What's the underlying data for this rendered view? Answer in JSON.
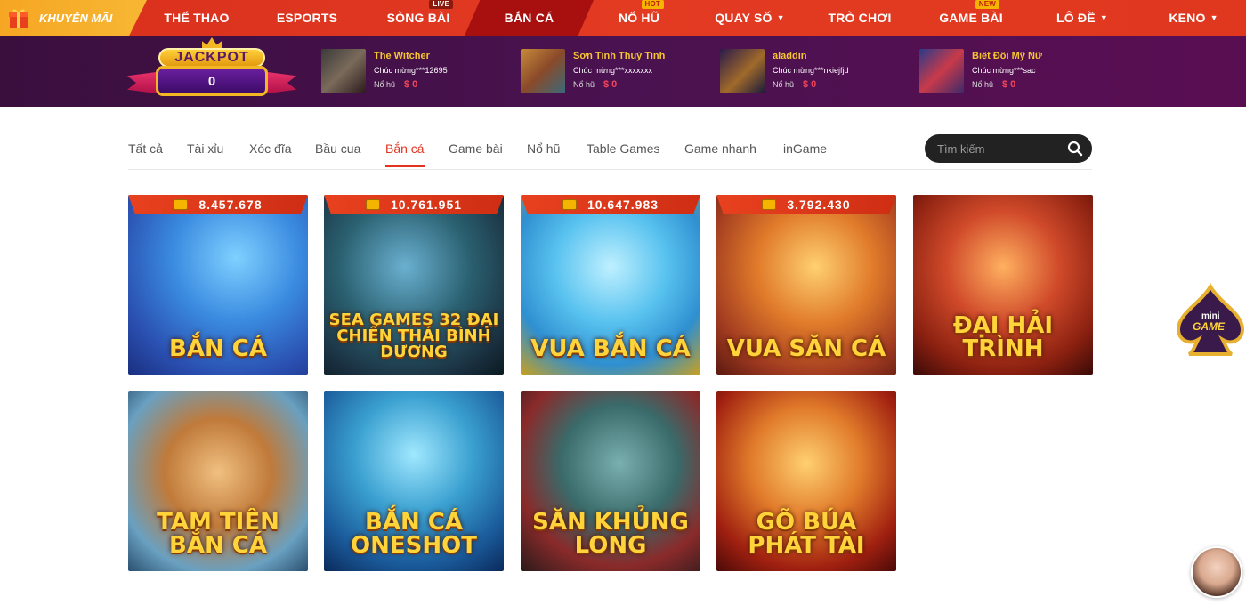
{
  "nav": {
    "promo_label": "KHUYẾN MÃI",
    "items": [
      {
        "label": "THỂ THAO",
        "badge": ""
      },
      {
        "label": "ESPORTS",
        "badge": ""
      },
      {
        "label": "SÒNG BÀI",
        "badge": "LIVE"
      },
      {
        "label": "BẮN CÁ",
        "badge": "",
        "active": true
      },
      {
        "label": "NỔ HŨ",
        "badge": "HOT"
      },
      {
        "label": "QUAY SỐ",
        "badge": "",
        "dropdown": true
      },
      {
        "label": "TRÒ CHƠI",
        "badge": ""
      },
      {
        "label": "GAME BÀI",
        "badge": "NEW"
      },
      {
        "label": "LÔ ĐỀ",
        "badge": "",
        "dropdown": true
      },
      {
        "label": "KENO",
        "badge": "",
        "dropdown": true
      }
    ]
  },
  "jackpot": {
    "title": "JACKPOT",
    "value": "0"
  },
  "winners": [
    {
      "game": "The Witcher",
      "congrats": "Chúc mừng***12695",
      "label": "Nổ hũ",
      "amount": "$ 0"
    },
    {
      "game": "Sơn Tinh Thuỷ Tinh",
      "congrats": "Chúc mừng***xxxxxxx",
      "label": "Nổ hũ",
      "amount": "$ 0"
    },
    {
      "game": "aladdin",
      "congrats": "Chúc mừng***nkiejfjd",
      "label": "Nổ hũ",
      "amount": "$ 0"
    },
    {
      "game": "Biệt Đội Mỹ Nữ",
      "congrats": "Chúc mừng***sac",
      "label": "Nổ hũ",
      "amount": "$ 0"
    }
  ],
  "tabs": [
    "Tất cả",
    "Tài xỉu",
    "Xóc đĩa",
    "Bầu cua",
    "Bắn cá",
    "Game bài",
    "Nổ hũ",
    "Table Games",
    "Game nhanh",
    "inGame"
  ],
  "active_tab": "Bắn cá",
  "search": {
    "placeholder": "Tìm kiếm"
  },
  "games": [
    {
      "title": "BẮN CÁ",
      "jackpot": "8.457.678"
    },
    {
      "title": "SEA GAMES 32 ĐẠI CHIẾN THÁI BÌNH DƯƠNG",
      "jackpot": "10.761.951"
    },
    {
      "title": "VUA BẮN CÁ",
      "jackpot": "10.647.983"
    },
    {
      "title": "VUA SĂN CÁ",
      "jackpot": "3.792.430"
    },
    {
      "title": "ĐẠI HẢI TRÌNH",
      "jackpot": ""
    },
    {
      "title": "TAM TIÊN BẮN CÁ",
      "jackpot": ""
    },
    {
      "title": "BẮN CÁ ONESHOT",
      "jackpot": ""
    },
    {
      "title": "SĂN KHỦNG LONG",
      "jackpot": ""
    },
    {
      "title": "GÕ BÚA PHÁT TÀI",
      "jackpot": ""
    }
  ],
  "minigame": {
    "line1": "mini",
    "line2": "GAME"
  },
  "colors": {
    "nav_red": "#e23b22",
    "accent": "#e0341f",
    "jackpot_purple": "#4a1250",
    "gold": "#f7c531"
  }
}
